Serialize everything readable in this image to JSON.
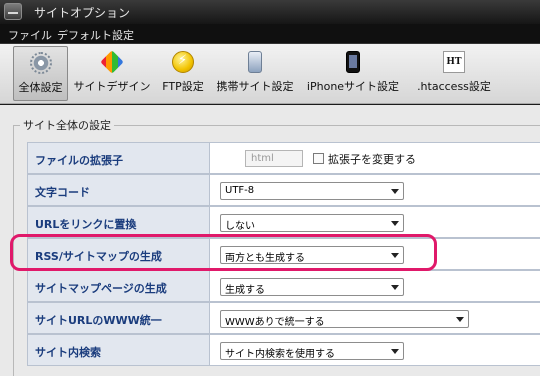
{
  "window": {
    "title": "サイトオプション"
  },
  "menu": {
    "items": [
      "ファイル",
      "デフォルト設定"
    ]
  },
  "toolbar": {
    "tools": [
      {
        "label": "全体設定",
        "icon": "gear-icon",
        "active": true
      },
      {
        "label": "サイトデザイン",
        "icon": "design-icon"
      },
      {
        "label": "FTP設定",
        "icon": "ftp-icon"
      },
      {
        "label": "携帯サイト設定",
        "icon": "mobile-phone-icon"
      },
      {
        "label": "iPhoneサイト設定",
        "icon": "iphone-icon"
      },
      {
        "label": ".htaccess設定",
        "icon": "htaccess-icon"
      }
    ],
    "ht_glyph": "HT"
  },
  "settings": {
    "group_title": "サイト全体の設定",
    "rows": [
      {
        "label": "ファイルの拡張子",
        "input_value": "html",
        "checkbox_label": "拡張子を変更する",
        "checked": false
      },
      {
        "label": "文字コード",
        "value": "UTF-8"
      },
      {
        "label": "URLをリンクに置換",
        "value": "しない"
      },
      {
        "label": "RSS/サイトマップの生成",
        "value": "両方とも生成する",
        "highlighted": true
      },
      {
        "label": "サイトマップページの生成",
        "value": "生成する"
      },
      {
        "label": "サイトURLのWWW統一",
        "value": "WWWありで統一する"
      },
      {
        "label": "サイト内検索",
        "value": "サイト内検索を使用する"
      }
    ]
  },
  "colors": {
    "highlight": "#e0196a",
    "label_text": "#1a3c7d",
    "label_bg": "#e2e7ef"
  }
}
